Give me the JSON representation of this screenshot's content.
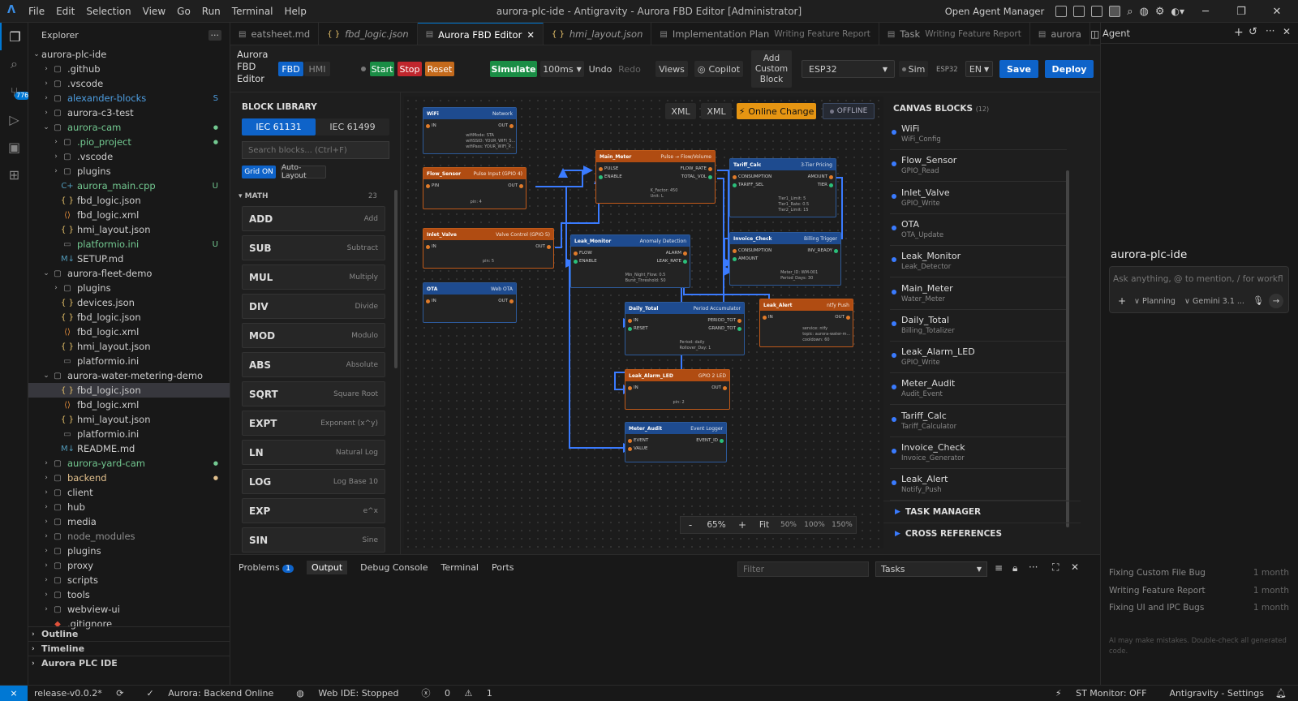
{
  "window": {
    "menu": [
      "File",
      "Edit",
      "Selection",
      "View",
      "Go",
      "Run",
      "Terminal",
      "Help"
    ],
    "title": "aurora-plc-ide - Antigravity - Aurora FBD Editor [Administrator]",
    "agent_manager": "Open Agent Manager"
  },
  "activity": {
    "badge": "776"
  },
  "explorer": {
    "title": "Explorer",
    "more": "···",
    "rows": [
      {
        "label": "aurora-plc-ide",
        "depth": 0,
        "kind": "root",
        "open": true
      },
      {
        "label": ".github",
        "depth": 1,
        "kind": "folder"
      },
      {
        "label": ".vscode",
        "depth": 1,
        "kind": "folder"
      },
      {
        "label": "alexander-blocks",
        "depth": 1,
        "kind": "folder",
        "status": "S",
        "color": "#4d9de0"
      },
      {
        "label": "aurora-c3-test",
        "depth": 1,
        "kind": "folder"
      },
      {
        "label": "aurora-cam",
        "depth": 1,
        "kind": "folder",
        "open": true,
        "color": "#73c991",
        "dotstat": true
      },
      {
        "label": ".pio_project",
        "depth": 2,
        "kind": "folder",
        "color": "#73c991",
        "dotstat": true
      },
      {
        "label": ".vscode",
        "depth": 2,
        "kind": "folder"
      },
      {
        "label": "plugins",
        "depth": 2,
        "kind": "folder"
      },
      {
        "label": "aurora_main.cpp",
        "depth": 2,
        "kind": "cpp",
        "status": "U",
        "color": "#73c991"
      },
      {
        "label": "fbd_logic.json",
        "depth": 2,
        "kind": "json"
      },
      {
        "label": "fbd_logic.xml",
        "depth": 2,
        "kind": "xml"
      },
      {
        "label": "hmi_layout.json",
        "depth": 2,
        "kind": "json"
      },
      {
        "label": "platformio.ini",
        "depth": 2,
        "kind": "ini",
        "status": "U",
        "color": "#73c991"
      },
      {
        "label": "SETUP.md",
        "depth": 2,
        "kind": "md"
      },
      {
        "label": "aurora-fleet-demo",
        "depth": 1,
        "kind": "folder",
        "open": true
      },
      {
        "label": "plugins",
        "depth": 2,
        "kind": "folder"
      },
      {
        "label": "devices.json",
        "depth": 2,
        "kind": "json"
      },
      {
        "label": "fbd_logic.json",
        "depth": 2,
        "kind": "json"
      },
      {
        "label": "fbd_logic.xml",
        "depth": 2,
        "kind": "xml"
      },
      {
        "label": "hmi_layout.json",
        "depth": 2,
        "kind": "json"
      },
      {
        "label": "platformio.ini",
        "depth": 2,
        "kind": "ini"
      },
      {
        "label": "aurora-water-metering-demo",
        "depth": 1,
        "kind": "folder",
        "open": true
      },
      {
        "label": "fbd_logic.json",
        "depth": 2,
        "kind": "json",
        "selected": true
      },
      {
        "label": "fbd_logic.xml",
        "depth": 2,
        "kind": "xml"
      },
      {
        "label": "hmi_layout.json",
        "depth": 2,
        "kind": "json"
      },
      {
        "label": "platformio.ini",
        "depth": 2,
        "kind": "ini"
      },
      {
        "label": "README.md",
        "depth": 2,
        "kind": "md"
      },
      {
        "label": "aurora-yard-cam",
        "depth": 1,
        "kind": "folder",
        "color": "#73c991",
        "dotstat": true
      },
      {
        "label": "backend",
        "depth": 1,
        "kind": "folder",
        "color": "#e2c08d",
        "dotstat": true
      },
      {
        "label": "client",
        "depth": 1,
        "kind": "folder"
      },
      {
        "label": "hub",
        "depth": 1,
        "kind": "folder"
      },
      {
        "label": "media",
        "depth": 1,
        "kind": "folder"
      },
      {
        "label": "node_modules",
        "depth": 1,
        "kind": "folder",
        "color": "#8c8c8c"
      },
      {
        "label": "plugins",
        "depth": 1,
        "kind": "folder"
      },
      {
        "label": "proxy",
        "depth": 1,
        "kind": "folder"
      },
      {
        "label": "scripts",
        "depth": 1,
        "kind": "folder"
      },
      {
        "label": "tools",
        "depth": 1,
        "kind": "folder"
      },
      {
        "label": "webview-ui",
        "depth": 1,
        "kind": "folder"
      },
      {
        "label": ".gitignore",
        "depth": 1,
        "kind": "git"
      }
    ],
    "sections": [
      "Outline",
      "Timeline",
      "Aurora PLC IDE"
    ]
  },
  "tabs": [
    {
      "label": "eatsheet.md",
      "sub": ""
    },
    {
      "label": "fbd_logic.json",
      "sub": "",
      "icon": "{ }"
    },
    {
      "label": "Aurora FBD Editor",
      "sub": "",
      "active": true,
      "close": "✕"
    },
    {
      "label": "hmi_layout.json",
      "sub": "",
      "icon": "{ }"
    },
    {
      "label": "Implementation Plan",
      "sub": "Writing Feature Report"
    },
    {
      "label": "Task",
      "sub": "Writing Feature Report"
    },
    {
      "label": "aurora",
      "sub": ""
    }
  ],
  "toolbar": {
    "app_title": "Aurora\nFBD\nEditor",
    "fbd": "FBD",
    "hmi": "HMI",
    "start": "Start",
    "stop": "Stop",
    "reset": "Reset",
    "simulate": "Simulate",
    "speed": "100ms",
    "undo": "Undo",
    "redo": "Redo",
    "views": "Views",
    "copilot": "Copilot",
    "add_custom": "Add\nCustom\nBlock",
    "board": "ESP32",
    "sim": "Sim",
    "board_small": "ESP32",
    "lang": "EN",
    "save": "Save",
    "deploy": "Deploy"
  },
  "library": {
    "title": "BLOCK LIBRARY",
    "std1": "IEC 61131",
    "std2": "IEC 61499",
    "search_placeholder": "Search blocks... (Ctrl+F)",
    "grid": "Grid ON",
    "autolayout": "Auto-Layout",
    "category": "MATH",
    "count": "23",
    "items": [
      {
        "n": "ADD",
        "d": "Add"
      },
      {
        "n": "SUB",
        "d": "Subtract"
      },
      {
        "n": "MUL",
        "d": "Multiply"
      },
      {
        "n": "DIV",
        "d": "Divide"
      },
      {
        "n": "MOD",
        "d": "Modulo"
      },
      {
        "n": "ABS",
        "d": "Absolute"
      },
      {
        "n": "SQRT",
        "d": "Square Root"
      },
      {
        "n": "EXPT",
        "d": "Exponent (x^y)"
      },
      {
        "n": "LN",
        "d": "Natural Log"
      },
      {
        "n": "LOG",
        "d": "Log Base 10"
      },
      {
        "n": "EXP",
        "d": "e^x"
      },
      {
        "n": "SIN",
        "d": "Sine"
      }
    ]
  },
  "canvas": {
    "xml1": "XML",
    "xml2": "XML",
    "online": "Online Change",
    "offline": "OFFLINE",
    "zoom": {
      "minus": "-",
      "value": "65%",
      "plus": "+",
      "fit": "Fit",
      "z50": "50%",
      "z100": "100%",
      "z150": "150%"
    }
  },
  "blocks": {
    "wifi": {
      "name": "WiFi",
      "type": "Network",
      "in": "IN",
      "out": "OUT",
      "params": [
        "wifiMode: STA",
        "wifiSSID: YOUR_WIFI_S...",
        "wifiPass: YOUR_WIFI_P..."
      ]
    },
    "flow": {
      "name": "Flow_Sensor",
      "type": "Pulse Input (GPIO 4)",
      "in": "PIN",
      "out": "OUT",
      "params": [
        "pin: 4"
      ]
    },
    "inlet": {
      "name": "Inlet_Valve",
      "type": "Valve Control (GPIO 5)",
      "in": "IN",
      "out": "OUT",
      "params": [
        "pin: 5"
      ]
    },
    "ota": {
      "name": "OTA",
      "type": "Web OTA",
      "in": "IN",
      "out": "OUT",
      "params": []
    },
    "main": {
      "name": "Main_Meter",
      "type": "Pulse → Flow/Volume",
      "in1": "PULSE",
      "in2": "ENABLE",
      "out1": "FLOW_RATE",
      "out2": "TOTAL_VOL",
      "params": [
        "K_Factor: 450",
        "Unit: L"
      ]
    },
    "leak": {
      "name": "Leak_Monitor",
      "type": "Anomaly Detection",
      "in1": "FLOW",
      "in2": "ENABLE",
      "out1": "ALARM",
      "out2": "LEAK_RATE",
      "params": [
        "Min_Night_Flow: 0.5",
        "Burst_Threshold: 50"
      ]
    },
    "tariff": {
      "name": "Tariff_Calc",
      "type": "3-Tier Pricing",
      "in1": "CONSUMPTION",
      "in2": "TARIFF_SEL",
      "out1": "AMOUNT",
      "out2": "TIER",
      "params": [
        "Tier1_Limit: 5",
        "Tier1_Rate: 0.5",
        "Tier2_Limit: 15"
      ]
    },
    "invoice": {
      "name": "Invoice_Check",
      "type": "Billing Trigger",
      "in1": "CONSUMPTION",
      "in2": "AMOUNT",
      "out1": "INV_READY",
      "params": [
        "Meter_ID: WM-001",
        "Period_Days: 30"
      ]
    },
    "daily": {
      "name": "Daily_Total",
      "type": "Period Accumulator",
      "in1": "IN",
      "in2": "RESET",
      "out1": "PERIOD_TOT",
      "out2": "GRAND_TOT",
      "params": [
        "Period: daily",
        "Rollover_Day: 1"
      ]
    },
    "alert": {
      "name": "Leak_Alert",
      "type": "ntfy Push",
      "in1": "IN",
      "out1": "OUT",
      "params": [
        "service: ntfy",
        "topic: aurora-water-m...",
        "cooldown: 60"
      ]
    },
    "led": {
      "name": "Leak_Alarm_LED",
      "type": "GPIO 2 LED",
      "in": "IN",
      "out": "OUT",
      "params": [
        "pin: 2"
      ]
    },
    "audit": {
      "name": "Meter_Audit",
      "type": "Event Logger",
      "in1": "EVENT",
      "in2": "VALUE",
      "out1": "EVENT_ID",
      "params": []
    }
  },
  "canvas_blocks": {
    "title": "CANVAS BLOCKS",
    "count": "(12)",
    "items": [
      {
        "name": "WiFi",
        "type": "WiFi_Config"
      },
      {
        "name": "Flow_Sensor",
        "type": "GPIO_Read"
      },
      {
        "name": "Inlet_Valve",
        "type": "GPIO_Write"
      },
      {
        "name": "OTA",
        "type": "OTA_Update"
      },
      {
        "name": "Leak_Monitor",
        "type": "Leak_Detector"
      },
      {
        "name": "Main_Meter",
        "type": "Water_Meter"
      },
      {
        "name": "Daily_Total",
        "type": "Billing_Totalizer"
      },
      {
        "name": "Leak_Alarm_LED",
        "type": "GPIO_Write"
      },
      {
        "name": "Meter_Audit",
        "type": "Audit_Event"
      },
      {
        "name": "Tariff_Calc",
        "type": "Tariff_Calculator"
      },
      {
        "name": "Invoice_Check",
        "type": "Invoice_Generator"
      },
      {
        "name": "Leak_Alert",
        "type": "Notify_Push"
      }
    ],
    "task_manager": "TASK MANAGER",
    "cross_refs": "CROSS REFERENCES"
  },
  "panel": {
    "tabs": [
      "Problems",
      "Output",
      "Debug Console",
      "Terminal",
      "Ports"
    ],
    "problems_count": "1",
    "filter_placeholder": "Filter",
    "tasks": "Tasks"
  },
  "agent": {
    "title": "Agent",
    "workspace": "aurora-plc-ide",
    "input_placeholder": "Ask anything, @ to mention, / for workfl...",
    "mode": "Planning",
    "model": "Gemini 3.1 ...",
    "history": [
      {
        "t": "Fixing Custom File Bug",
        "a": "1 month"
      },
      {
        "t": "Writing Feature Report",
        "a": "1 month"
      },
      {
        "t": "Fixing UI and IPC Bugs",
        "a": "1 month"
      }
    ],
    "disclaimer": "AI may make mistakes. Double-check all generated code."
  },
  "status": {
    "branch": "release-v0.0.2*",
    "backend": "Aurora: Backend Online",
    "webide": "Web IDE: Stopped",
    "errors": "0",
    "warnings": "1",
    "monitor": "ST Monitor: OFF",
    "settings": "Antigravity - Settings"
  }
}
